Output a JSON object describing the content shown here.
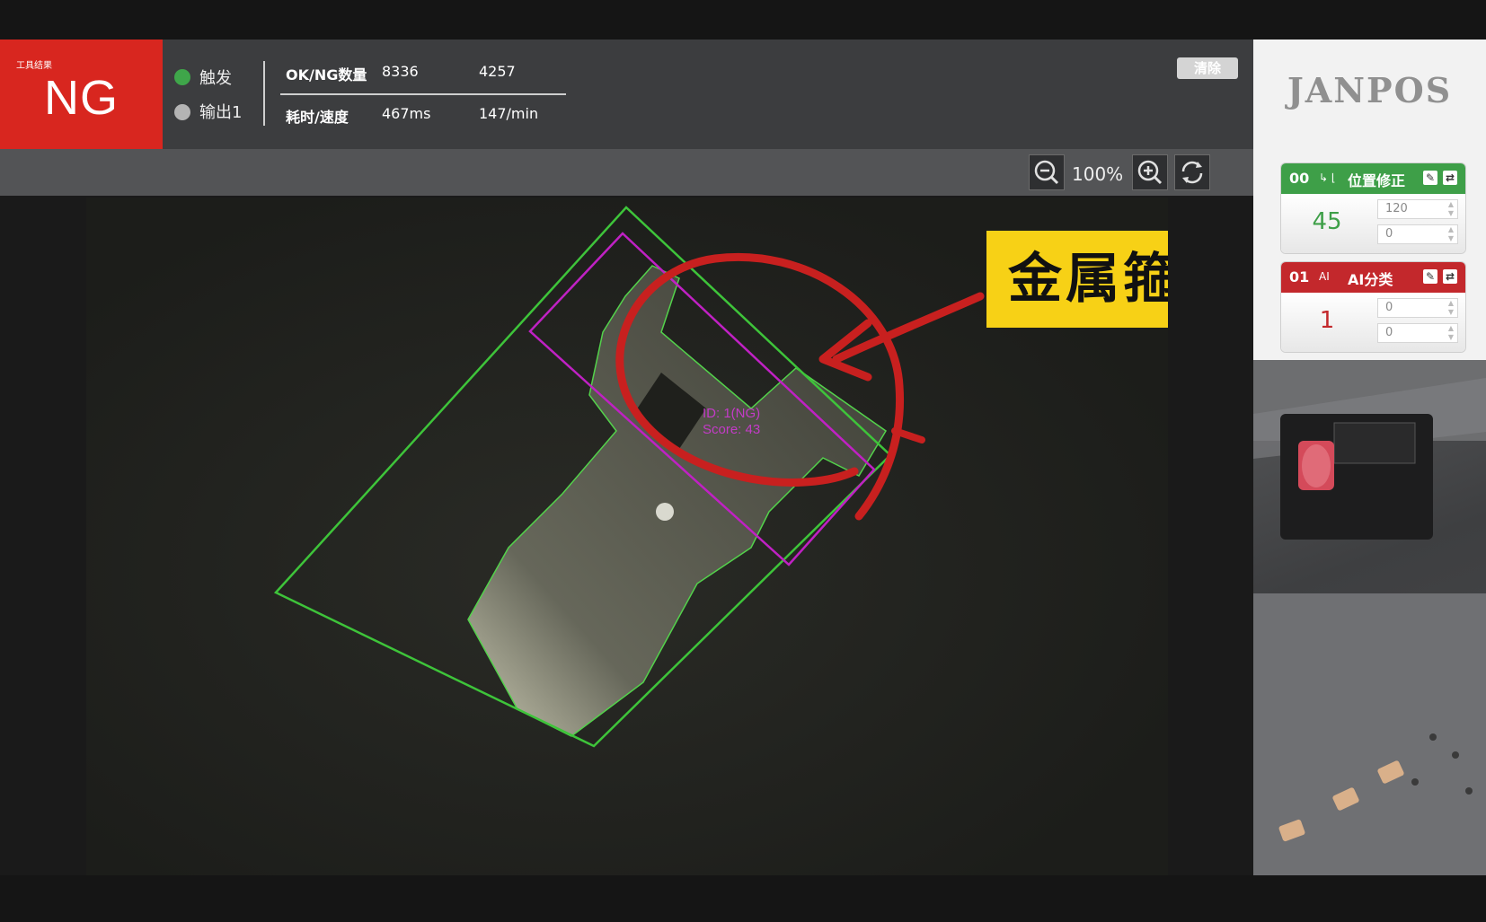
{
  "header": {
    "result_caption": "工具结果",
    "result": "NG",
    "io": [
      {
        "label": "触发",
        "color": "#3fa64a"
      },
      {
        "label": "输出1",
        "color": "#b4b4b4"
      }
    ],
    "stats": {
      "count_label": "OK/NG数量",
      "ok_count": "8336",
      "ng_count": "4257",
      "time_label": "耗时/速度",
      "time": "467ms",
      "speed": "147/min"
    },
    "clear_label": "清除"
  },
  "toolbar": {
    "zoom_out_icon": "zoom-out-icon",
    "zoom_level": "100%",
    "zoom_in_icon": "zoom-in-icon",
    "reset_icon": "refresh-icon"
  },
  "viewport": {
    "overlay_label_id": "ID: 1(NG)",
    "overlay_label_score": "Score: 43",
    "annotation": "金属箍漏装",
    "colors": {
      "roi": "#3ec43a",
      "match": "#c021c4",
      "circle": "#c8201f",
      "annotation_bg": "#f7d116"
    }
  },
  "brand": "JANPOS",
  "tools": [
    {
      "index": "00",
      "mini_icon": "↳ ⌊",
      "name": "位置修正",
      "status_color": "#3e9f48",
      "value": "45",
      "fields": [
        "120",
        "0"
      ]
    },
    {
      "index": "01",
      "mini_icon": "AI",
      "name": "AI分类",
      "status_color": "#c3282c",
      "value": "1",
      "fields": [
        "0",
        "0"
      ]
    }
  ]
}
